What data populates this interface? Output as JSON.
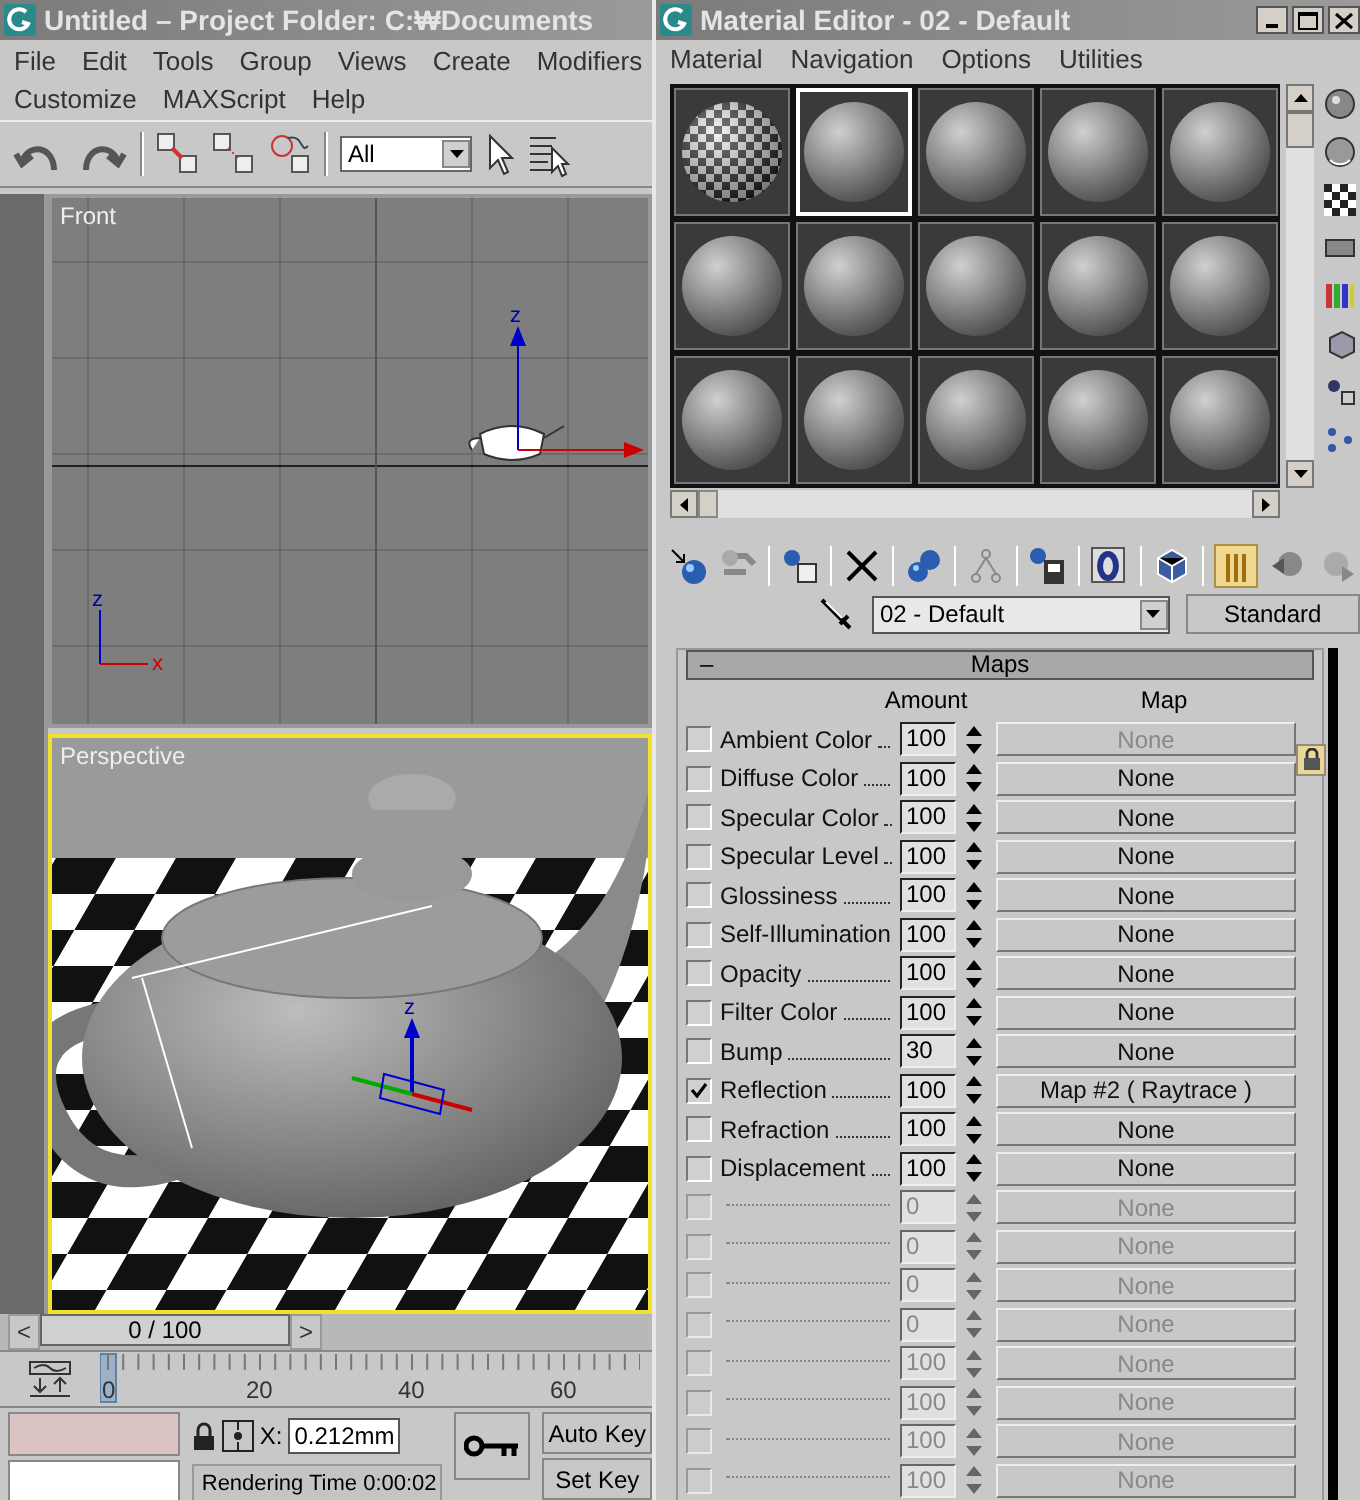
{
  "main_window": {
    "title": "Untitled     – Project Folder: C:₩Documents",
    "menu_rows": [
      [
        "File",
        "Edit",
        "Tools",
        "Group",
        "Views",
        "Create",
        "Modifiers"
      ],
      [
        "Customize",
        "MAXScript",
        "Help"
      ]
    ],
    "selection_filter": "All",
    "viewports": [
      {
        "label": "Front",
        "active": false,
        "kind": "grid",
        "gizmo_label": "z",
        "tripod_labels": [
          "z",
          "x"
        ]
      },
      {
        "label": "Perspective",
        "active": true,
        "kind": "scene",
        "gizmo_label": "z"
      }
    ],
    "time_slider": {
      "frame": "0 / 100",
      "prev": "<",
      "next": ">",
      "level": 0
    },
    "track_bar": {
      "ticks": [
        "0",
        "20",
        "40",
        "60"
      ]
    },
    "status": {
      "x_label": "X:",
      "x_value": "0.212mm",
      "rendering_time": "Rendering Time  0:00:02",
      "key_buttons": [
        "Auto Key",
        "Set Key"
      ]
    }
  },
  "material_editor": {
    "title": "Material Editor - 02 - Default",
    "menu": [
      "Material",
      "Navigation",
      "Options",
      "Utilities"
    ],
    "slots": [
      {
        "kind": "checker",
        "selected": false
      },
      {
        "kind": "sphere",
        "selected": true
      },
      {
        "kind": "sphere",
        "selected": false
      },
      {
        "kind": "sphere",
        "selected": false
      },
      {
        "kind": "sphere",
        "selected": false
      },
      {
        "kind": "sphere",
        "selected": false
      },
      {
        "kind": "sphere",
        "selected": false
      },
      {
        "kind": "sphere",
        "selected": false
      },
      {
        "kind": "sphere",
        "selected": false
      },
      {
        "kind": "sphere",
        "selected": false
      },
      {
        "kind": "sphere",
        "selected": false
      },
      {
        "kind": "sphere",
        "selected": false
      },
      {
        "kind": "sphere",
        "selected": false
      },
      {
        "kind": "sphere",
        "selected": false
      },
      {
        "kind": "sphere",
        "selected": false
      }
    ],
    "material_name": "02 - Default",
    "material_type": "Standard",
    "rollout": {
      "collapse": "–",
      "title": "Maps",
      "columns": [
        "Amount",
        "Map"
      ],
      "rows": [
        {
          "name": "Ambient Color",
          "checked": false,
          "amount": "100",
          "map": "None",
          "disabled": false,
          "map_disabled": true
        },
        {
          "name": "Diffuse Color",
          "checked": false,
          "amount": "100",
          "map": "None",
          "disabled": false,
          "map_disabled": false
        },
        {
          "name": "Specular Color",
          "checked": false,
          "amount": "100",
          "map": "None",
          "disabled": false,
          "map_disabled": false
        },
        {
          "name": "Specular Level",
          "checked": false,
          "amount": "100",
          "map": "None",
          "disabled": false,
          "map_disabled": false
        },
        {
          "name": "Glossiness",
          "checked": false,
          "amount": "100",
          "map": "None",
          "disabled": false,
          "map_disabled": false
        },
        {
          "name": "Self-Illumination",
          "checked": false,
          "amount": "100",
          "map": "None",
          "disabled": false,
          "map_disabled": false
        },
        {
          "name": "Opacity",
          "checked": false,
          "amount": "100",
          "map": "None",
          "disabled": false,
          "map_disabled": false
        },
        {
          "name": "Filter Color",
          "checked": false,
          "amount": "100",
          "map": "None",
          "disabled": false,
          "map_disabled": false
        },
        {
          "name": "Bump",
          "checked": false,
          "amount": "30",
          "map": "None",
          "disabled": false,
          "map_disabled": false
        },
        {
          "name": "Reflection",
          "checked": true,
          "amount": "100",
          "map": "Map #2  ( Raytrace )",
          "disabled": false,
          "map_disabled": false
        },
        {
          "name": "Refraction",
          "checked": false,
          "amount": "100",
          "map": "None",
          "disabled": false,
          "map_disabled": false
        },
        {
          "name": "Displacement",
          "checked": false,
          "amount": "100",
          "map": "None",
          "disabled": false,
          "map_disabled": false
        },
        {
          "checked": false,
          "amount": "0",
          "map": "None",
          "disabled": true,
          "map_disabled": true
        },
        {
          "checked": false,
          "amount": "0",
          "map": "None",
          "disabled": true,
          "map_disabled": true
        },
        {
          "checked": false,
          "amount": "0",
          "map": "None",
          "disabled": true,
          "map_disabled": true
        },
        {
          "checked": false,
          "amount": "0",
          "map": "None",
          "disabled": true,
          "map_disabled": true
        },
        {
          "checked": false,
          "amount": "100",
          "map": "None",
          "disabled": true,
          "map_disabled": true
        },
        {
          "checked": false,
          "amount": "100",
          "map": "None",
          "disabled": true,
          "map_disabled": true
        },
        {
          "checked": false,
          "amount": "100",
          "map": "None",
          "disabled": true,
          "map_disabled": true
        },
        {
          "checked": false,
          "amount": "100",
          "map": "None",
          "disabled": true,
          "map_disabled": true
        }
      ]
    }
  }
}
